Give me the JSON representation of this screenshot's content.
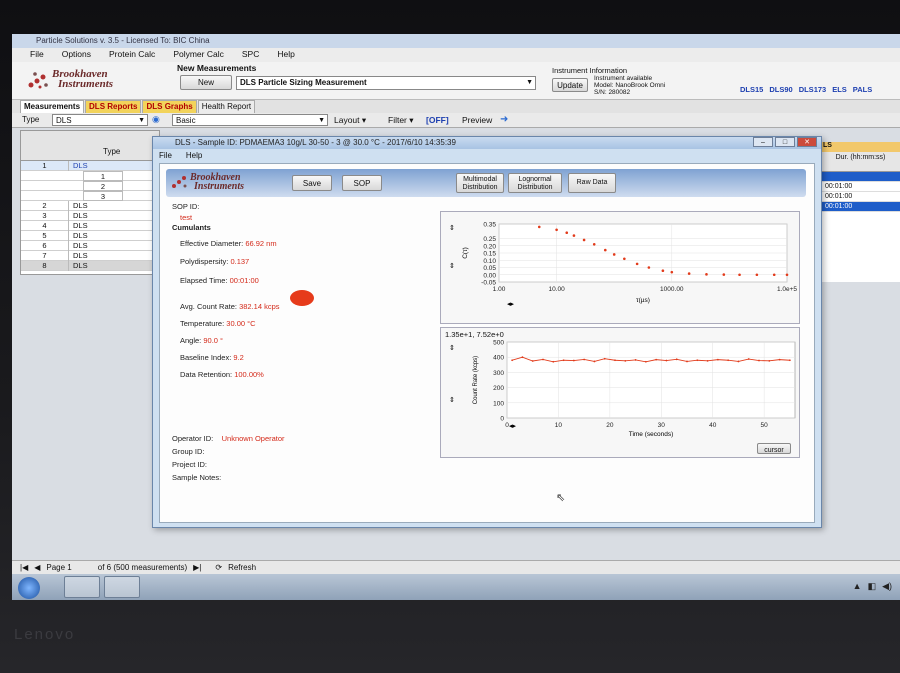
{
  "app": {
    "title": "Particle Solutions  v. 3.5 - Licensed To: BIC China",
    "menu": [
      "File",
      "Options",
      "Protein Calc",
      "Polymer Calc",
      "SPC",
      "Help"
    ],
    "logo_line1": "Brookhaven",
    "logo_line2": "Instruments",
    "new_measurements_title": "New Measurements",
    "new_button": "New",
    "measurement_select": "DLS Particle Sizing Measurement",
    "instrument_info_title": "Instrument Information",
    "update_button": "Update",
    "instrument_lines": [
      "Instrument available",
      "Model: NanoBrook Omni",
      "S/N: 280082"
    ],
    "modes": [
      "DLS15",
      "DLS90",
      "DLS173",
      "ELS",
      "PALS"
    ]
  },
  "tabs": [
    "Measurements",
    "DLS Reports",
    "DLS Graphs",
    "Health Report"
  ],
  "toolbar": {
    "type_label": "Type",
    "type_value": "DLS",
    "view_value": "Basic",
    "layout_label": "Layout ▾",
    "filter_label": "Filter ▾",
    "filter_state": "[OFF]",
    "preview_label": "Preview"
  },
  "grid": {
    "header_type": "Type",
    "rows": [
      {
        "num": "1",
        "type": "DLS"
      },
      {
        "num": "1",
        "type": ""
      },
      {
        "num": "2",
        "type": ""
      },
      {
        "num": "3",
        "type": ""
      },
      {
        "num": "2",
        "type": "DLS"
      },
      {
        "num": "3",
        "type": "DLS"
      },
      {
        "num": "4",
        "type": "DLS"
      },
      {
        "num": "5",
        "type": "DLS"
      },
      {
        "num": "6",
        "type": "DLS"
      },
      {
        "num": "7",
        "type": "DLS"
      },
      {
        "num": "8",
        "type": "DLS"
      }
    ],
    "right_header": "LS",
    "right_col": "Dur. (hh:mm:ss)",
    "right_rows": [
      "",
      "00:01:00",
      "00:01:00",
      "00:01:00"
    ]
  },
  "dialog": {
    "title": "DLS - Sample ID: PDMAEMA3 10g/L 30-50 - 3 @ 30.0 °C - 2017/6/10 14:35:39",
    "menu": [
      "File",
      "Help"
    ],
    "buttons": {
      "save": "Save",
      "sop": "SOP",
      "multimodal": "Multimodal Distribution",
      "lognormal": "Lognormal Distribution",
      "raw": "Raw Data"
    },
    "sop_id_label": "SOP ID:",
    "sop_id_value": "test",
    "cumulants_label": "Cumulants",
    "results": [
      {
        "label": "Effective Diameter:",
        "value": "66.92 nm"
      },
      {
        "label": "Polydispersity:",
        "value": "0.137"
      },
      {
        "label": "Elapsed Time:",
        "value": "00:01:00"
      },
      {
        "label": "Avg. Count Rate:",
        "value": "382.14 kcps"
      },
      {
        "label": "Temperature:",
        "value": "30.00 °C"
      },
      {
        "label": "Angle:",
        "value": "90.0 °"
      },
      {
        "label": "Baseline Index:",
        "value": "9.2"
      },
      {
        "label": "Data Retention:",
        "value": "100.00%"
      }
    ],
    "operator_label": "Operator ID:",
    "operator_value": "Unknown Operator",
    "group_label": "Group ID:",
    "project_label": "Project ID:",
    "notes_label": "Sample Notes:",
    "plot2_header": "1.35e+1, 7.52e+0",
    "cursor_button": "cursor"
  },
  "statusbar": {
    "page_label": "Page 1",
    "of_label": "of 6 (500 measurements)",
    "refresh_label": "Refresh"
  },
  "monitor_brand": "Lenovo",
  "chart_data": [
    {
      "type": "scatter",
      "title": "",
      "xlabel": "τ(µs)",
      "ylabel": "C(τ)",
      "x_scale": "log",
      "xlim": [
        1,
        100000
      ],
      "ylim": [
        -0.05,
        0.35
      ],
      "x_ticks": [
        "1.00",
        "10.00",
        "1000.00",
        "1.0e+5"
      ],
      "y_ticks": [
        "0.35",
        "0.25",
        "0.20",
        "0.15",
        "0.10",
        "0.05",
        "0.00",
        "-0.05"
      ],
      "series": [
        {
          "x": [
            5,
            10,
            15,
            20,
            30,
            45,
            70,
            100,
            150,
            250,
            400,
            700,
            1000,
            2000,
            4000,
            8000,
            15000,
            30000,
            60000,
            100000
          ],
          "y": [
            0.33,
            0.31,
            0.29,
            0.27,
            0.24,
            0.21,
            0.17,
            0.14,
            0.11,
            0.075,
            0.05,
            0.028,
            0.018,
            0.008,
            0.003,
            0.001,
            0.0,
            0.0,
            0.0,
            0.0
          ]
        }
      ]
    },
    {
      "type": "line",
      "title": "",
      "xlabel": "Time (seconds)",
      "ylabel": "Count Rate (kcps)",
      "xlim": [
        0,
        56
      ],
      "ylim": [
        0,
        500
      ],
      "x_ticks": [
        "0",
        "10",
        "20",
        "30",
        "40",
        "50"
      ],
      "y_ticks": [
        "500",
        "400",
        "300",
        "200",
        "100",
        "0"
      ],
      "series": [
        {
          "x": [
            1,
            3,
            5,
            7,
            9,
            11,
            13,
            15,
            17,
            19,
            21,
            23,
            25,
            27,
            29,
            31,
            33,
            35,
            37,
            39,
            41,
            43,
            45,
            47,
            49,
            51,
            53,
            55
          ],
          "y": [
            380,
            400,
            375,
            385,
            370,
            380,
            378,
            385,
            372,
            390,
            380,
            376,
            382,
            370,
            384,
            378,
            386,
            372,
            380,
            376,
            384,
            380,
            372,
            388,
            378,
            376,
            384,
            380
          ]
        }
      ]
    }
  ]
}
